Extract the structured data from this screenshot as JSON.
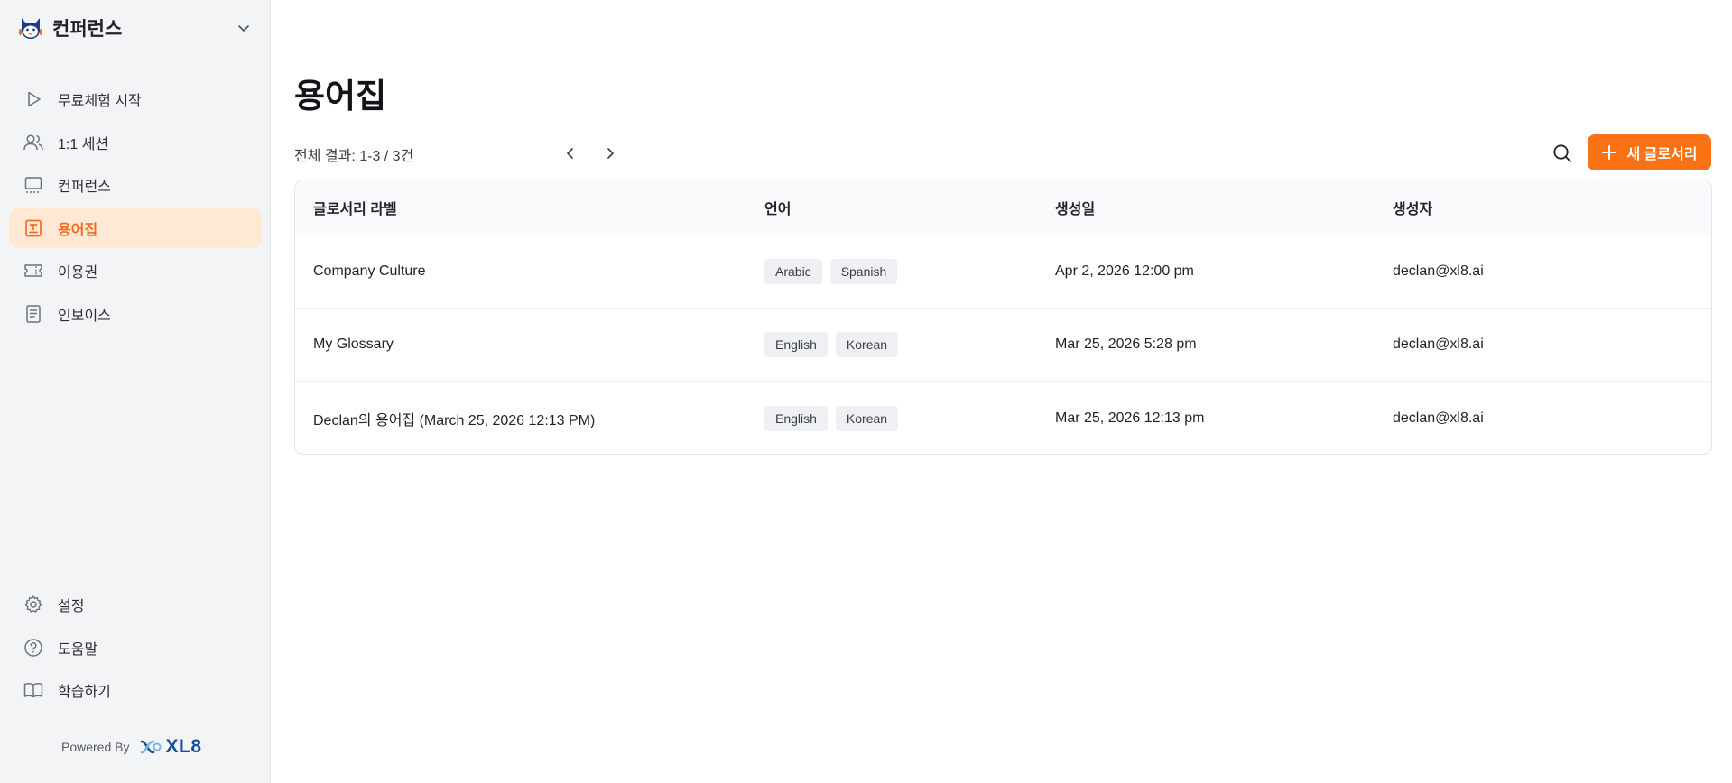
{
  "workspace": {
    "name": "컨퍼런스"
  },
  "sidebar": {
    "items": [
      {
        "label": "무료체험 시작",
        "icon": "play-icon"
      },
      {
        "label": "1:1 세션",
        "icon": "users-icon"
      },
      {
        "label": "컨퍼런스",
        "icon": "monitor-icon"
      },
      {
        "label": "용어집",
        "icon": "glossary-icon",
        "active": true
      },
      {
        "label": "이용권",
        "icon": "ticket-icon"
      },
      {
        "label": "인보이스",
        "icon": "invoice-icon"
      }
    ],
    "bottom_items": [
      {
        "label": "설정",
        "icon": "gear-icon"
      },
      {
        "label": "도움말",
        "icon": "help-icon"
      },
      {
        "label": "학습하기",
        "icon": "book-icon"
      }
    ],
    "powered_by": "Powered By",
    "brand": "XL8"
  },
  "main": {
    "title": "용어집",
    "results_text": "전체 결과: 1-3 / 3건",
    "new_button_label": "새 글로서리",
    "table": {
      "headers": [
        "글로서리 라벨",
        "언어",
        "생성일",
        "생성자"
      ],
      "rows": [
        {
          "label": "Company Culture",
          "languages": [
            "Arabic",
            "Spanish"
          ],
          "created": "Apr 2, 2026 12:00 pm",
          "creator": "declan@xl8.ai"
        },
        {
          "label": "My Glossary",
          "languages": [
            "English",
            "Korean"
          ],
          "created": "Mar 25, 2026 5:28 pm",
          "creator": "declan@xl8.ai"
        },
        {
          "label": "Declan의 용어집 (March 25, 2026 12:13 PM)",
          "languages": [
            "English",
            "Korean"
          ],
          "created": "Mar 25, 2026 12:13 pm",
          "creator": "declan@xl8.ai"
        }
      ]
    }
  },
  "colors": {
    "accent": "#f97316",
    "active_bg": "#ffe8d4",
    "sidebar_bg": "#f3f4f6",
    "brand_blue": "#1a4fa0"
  }
}
